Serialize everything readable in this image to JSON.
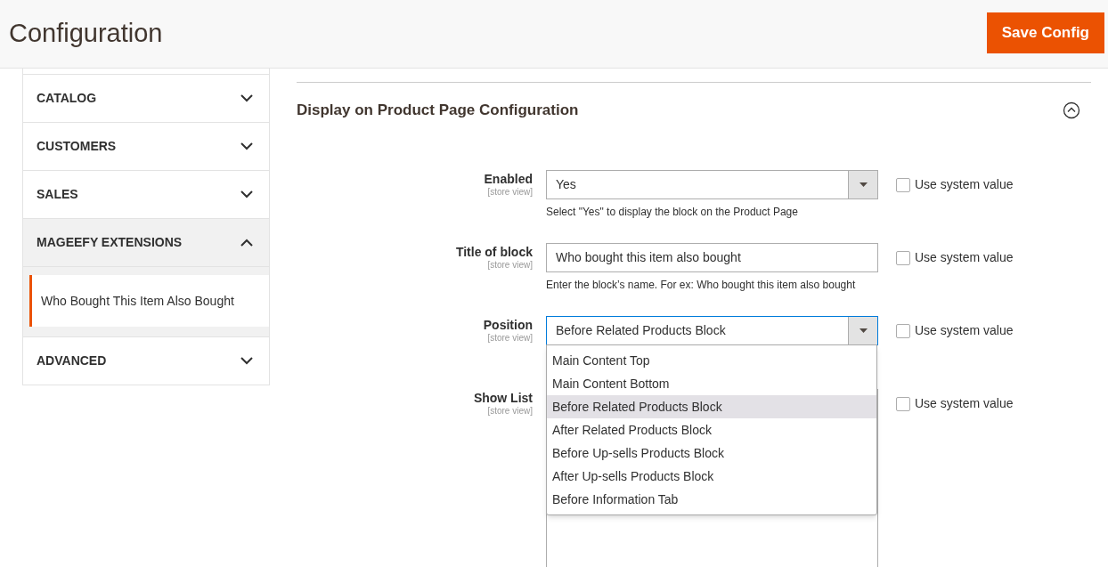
{
  "header": {
    "title": "Configuration",
    "save_button": "Save Config"
  },
  "sidebar": {
    "sections": [
      {
        "label": "CATALOG",
        "expanded": false
      },
      {
        "label": "CUSTOMERS",
        "expanded": false
      },
      {
        "label": "SALES",
        "expanded": false
      },
      {
        "label": "MAGEEFY EXTENSIONS",
        "expanded": true,
        "children": [
          {
            "label": "Who Bought This Item Also Bought",
            "selected": true
          }
        ]
      },
      {
        "label": "ADVANCED",
        "expanded": false
      }
    ]
  },
  "section": {
    "title": "Display on Product Page Configuration",
    "expanded": true,
    "fields": [
      {
        "kind": "select",
        "label": "Enabled",
        "scope": "[store view]",
        "value": "Yes",
        "note": "Select \"Yes\" to display the block on the Product Page",
        "focused": false,
        "use_system_value": {
          "label": "Use system value",
          "checked": false
        }
      },
      {
        "kind": "text",
        "label": "Title of block",
        "scope": "[store view]",
        "value": "Who bought this item also bought",
        "note": "Enter the block’s name. For ex: Who bought this item also bought",
        "focused": false,
        "use_system_value": {
          "label": "Use system value",
          "checked": false
        }
      },
      {
        "kind": "select",
        "label": "Position",
        "scope": "[store view]",
        "value": "Before Related Products Block",
        "focused": true,
        "open": true,
        "options": [
          {
            "label": "Main Content Top",
            "selected": false
          },
          {
            "label": "Main Content Bottom",
            "selected": false
          },
          {
            "label": "Before Related Products Block",
            "selected": true
          },
          {
            "label": "After Related Products Block",
            "selected": false
          },
          {
            "label": "Before Up-sells Products Block",
            "selected": false
          },
          {
            "label": "After Up-sells Products Block",
            "selected": false
          },
          {
            "label": "Before Information Tab",
            "selected": false
          }
        ],
        "use_system_value": {
          "label": "Use system value",
          "checked": false
        }
      },
      {
        "kind": "multiselect",
        "label": "Show List",
        "scope": "[store view]",
        "focused": false,
        "use_system_value": {
          "label": "Use system value",
          "checked": false
        }
      }
    ]
  }
}
